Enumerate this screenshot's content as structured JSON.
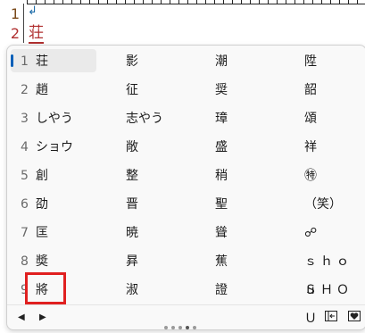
{
  "editor": {
    "line1_number": "1",
    "line1_mark": "↲",
    "line2_number": "2",
    "line2_text": "荘"
  },
  "candidates": [
    {
      "num": "1",
      "cols": [
        "荘",
        "影",
        "潮",
        "陞"
      ]
    },
    {
      "num": "2",
      "cols": [
        "趙",
        "征",
        "奨",
        "韶"
      ]
    },
    {
      "num": "3",
      "cols": [
        "しやう",
        "志やう",
        "璋",
        "頌"
      ]
    },
    {
      "num": "4",
      "cols": [
        "ショウ",
        "敞",
        "盛",
        "祥"
      ]
    },
    {
      "num": "5",
      "cols": [
        "創",
        "整",
        "稍",
        "㊕"
      ]
    },
    {
      "num": "6",
      "cols": [
        "劭",
        "晋",
        "聖",
        "（笑）"
      ]
    },
    {
      "num": "7",
      "cols": [
        "匡",
        "暁",
        "聳",
        "☍"
      ]
    },
    {
      "num": "8",
      "cols": [
        "奬",
        "昪",
        "蕉",
        "ｓｈｏｕ"
      ]
    },
    {
      "num": "9",
      "cols": [
        "將",
        "淑",
        "證",
        "ＳＨＯＵ"
      ]
    }
  ],
  "selected_index": 0,
  "footer": {
    "prev_icon": "◀",
    "next_icon": "▶",
    "page_count": 5,
    "active_page": 4
  },
  "colors": {
    "accent": "#005fb8",
    "highlight": "#e02020",
    "composition": "#b03030"
  }
}
